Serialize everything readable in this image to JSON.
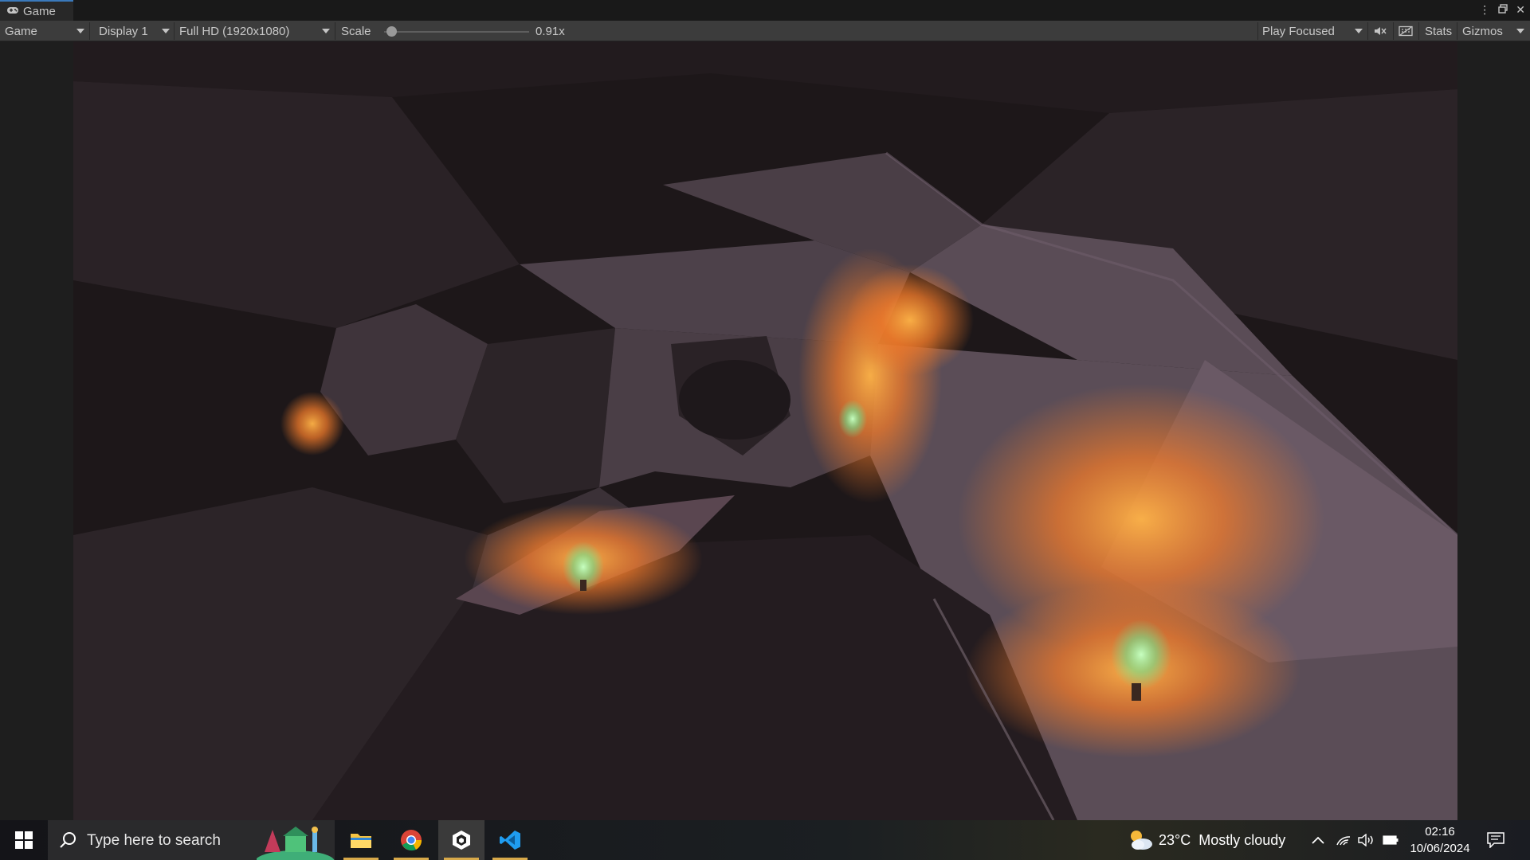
{
  "window": {
    "tab_label": "Game",
    "tab_icon": "gamepad-icon",
    "controls": [
      "more-icon",
      "maximize-icon",
      "close-icon"
    ]
  },
  "toolbar": {
    "mode_select": "Game",
    "display_select": "Display 1",
    "resolution_select": "Full HD (1920x1080)",
    "scale_label": "Scale",
    "scale_value": "0.91x",
    "scale_slider_fraction": 0.05,
    "play_mode_select": "Play Focused",
    "mute_icon": "mute-audio-icon",
    "shortcuts_icon": "keyboard-icon",
    "stats_label": "Stats",
    "gizmos_label": "Gizmos"
  },
  "game_view": {
    "scene": "low-poly cave interior lit by three glowing green torches"
  },
  "taskbar": {
    "search_placeholder": "Type here to search",
    "weather_temp": "23°C",
    "weather_desc": "Mostly cloudy",
    "time": "02:16",
    "date": "10/06/2024",
    "apps": [
      "file-explorer-icon",
      "chrome-icon",
      "unity-icon",
      "vscode-icon"
    ]
  },
  "colors": {
    "accent": "#3a79bb",
    "toolbar_bg": "#3c3c3c",
    "torch_glow": "#f07a2a",
    "taskbar_underline": "#d7a94a"
  }
}
